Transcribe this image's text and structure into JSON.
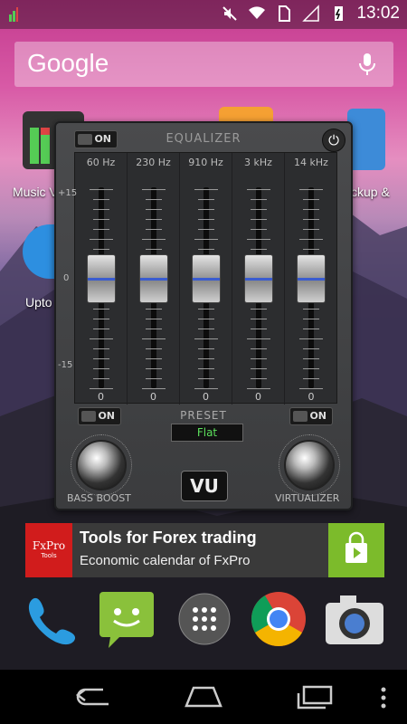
{
  "status": {
    "time": "13:02"
  },
  "search": {
    "logo": "Google"
  },
  "home": {
    "music_label": "Music V",
    "backup_label": "ckup &",
    "upto_label": "Upto"
  },
  "equalizer": {
    "title": "EQUALIZER",
    "main_toggle": "ON",
    "bands": [
      {
        "freq": "60 Hz",
        "value": "0"
      },
      {
        "freq": "230 Hz",
        "value": "0"
      },
      {
        "freq": "910 Hz",
        "value": "0"
      },
      {
        "freq": "3 kHz",
        "value": "0"
      },
      {
        "freq": "14 kHz",
        "value": "0"
      }
    ],
    "scale": {
      "top": "+15",
      "mid": "0",
      "bottom": "-15"
    },
    "preset_title": "PRESET",
    "preset_value": "Flat",
    "bass_toggle": "ON",
    "virt_toggle": "ON",
    "bass_label": "BASS BOOST",
    "virt_label": "VIRTUALIZER",
    "vu_label": "VU"
  },
  "ad": {
    "logo_text": "FxPro",
    "logo_sub": "Tools",
    "title": "Tools for Forex trading",
    "subtitle": "Economic calendar of FxPro"
  },
  "colors": {
    "accent_green": "#5ce15c",
    "ad_red": "#d11c1c",
    "play_green": "#7cbb2b",
    "slider_blue": "#3a5cd0"
  }
}
